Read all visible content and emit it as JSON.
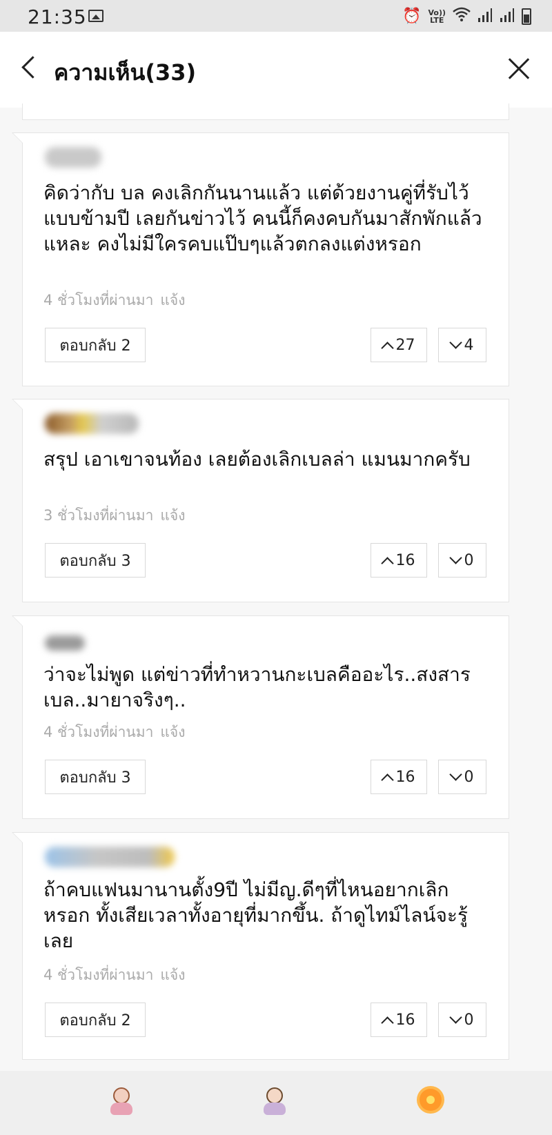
{
  "status_bar": {
    "time": "21:35",
    "left_icons": [
      "image-icon"
    ],
    "right_icons": [
      "alarm-icon",
      "volte-icon",
      "wifi-icon",
      "signal-icon",
      "signal-icon",
      "battery-icon"
    ],
    "volte_top": "Vo))",
    "volte_bottom": "LTE"
  },
  "header": {
    "title": "ความเห็น(33)",
    "back_icon": "chevron-left-icon",
    "close_icon": "close-icon"
  },
  "comments": [
    {
      "text": "คิดว่ากับ บล คงเลิกกันนานแล้ว แต่ด้วยงานคู่ที่รับไว้แบบข้ามปี เลยกันข่าวไว้ คนนี้ก็คงคบกันมาสักพักแล้วแหละ คงไม่มีใครคบแป๊บๆแล้วตกลงแต่งหรอก",
      "time": "4 ชั่วโมงที่ผ่านมา",
      "report": "แจ้ง",
      "reply": "ตอบกลับ 2",
      "up": "27",
      "down": "4"
    },
    {
      "text": "สรุป เอาเขาจนท้อง เลยต้องเลิกเบลล่า แมนมากครับ",
      "time": "3 ชั่วโมงที่ผ่านมา",
      "report": "แจ้ง",
      "reply": "ตอบกลับ 3",
      "up": "16",
      "down": "0"
    },
    {
      "text": "ว่าจะไม่พูด แต่ข่าวที่ทำหวานกะเบลคืออะไร..สงสารเบล..มายาจริงๆ..",
      "time": "4 ชั่วโมงที่ผ่านมา",
      "report": "แจ้ง",
      "reply": "ตอบกลับ 3",
      "up": "16",
      "down": "0"
    },
    {
      "text": "ถ้าคบแฟนมานานตั้ง9ปี ไม่มีญ.ดีๆที่ไหนอยากเลิกหรอก ทั้งเสียเวลาทั้งอายุที่มากขึ้น. ถ้าดูไทม์ไลน์จะรู้เลย",
      "time": "4 ชั่วโมงที่ผ่านมา",
      "report": "แจ้ง",
      "reply": "ตอบกลับ 2",
      "up": "16",
      "down": "0"
    }
  ],
  "colors": {
    "card_bg": "#ffffff",
    "page_bg": "#f7f7f7",
    "meta_text": "#aaaaaa",
    "border": "#e4e4e4"
  },
  "bottom_bar": {
    "stickers": [
      "girl-sticker-icon",
      "girl-sticker-icon",
      "flower-sticker-icon"
    ]
  }
}
